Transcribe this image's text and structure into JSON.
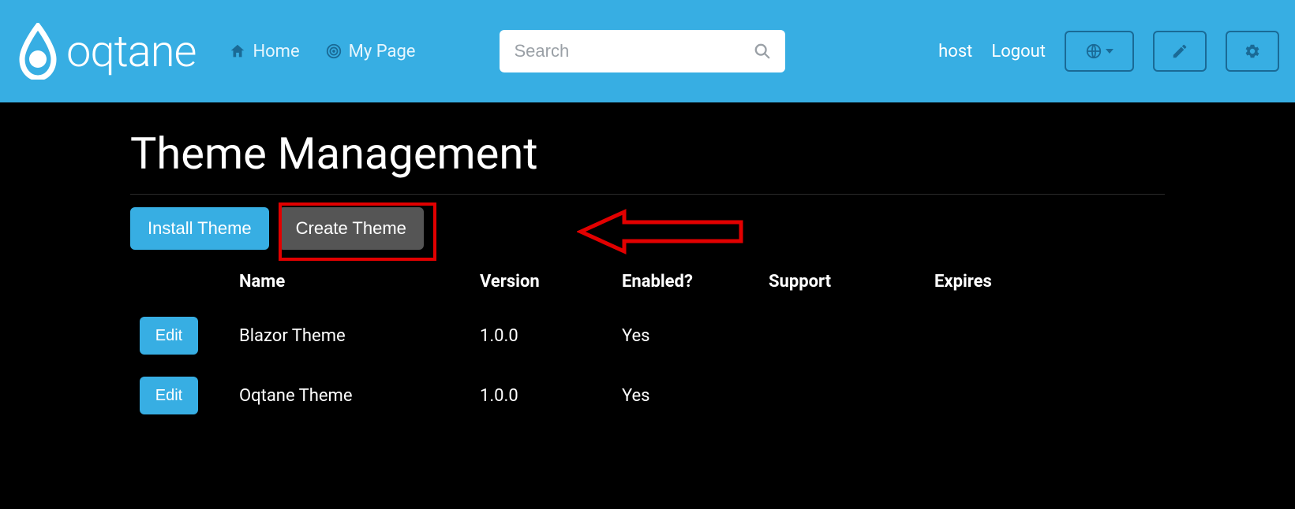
{
  "brand": {
    "name": "oqtane"
  },
  "nav": {
    "home": {
      "label": "Home"
    },
    "mypage": {
      "label": "My Page"
    }
  },
  "search": {
    "placeholder": "Search"
  },
  "user": {
    "name": "host",
    "logout": "Logout"
  },
  "page": {
    "title": "Theme Management",
    "install_label": "Install Theme",
    "create_label": "Create Theme"
  },
  "table": {
    "headers": {
      "name": "Name",
      "version": "Version",
      "enabled": "Enabled?",
      "support": "Support",
      "expires": "Expires"
    },
    "edit_label": "Edit",
    "rows": [
      {
        "name": "Blazor Theme",
        "version": "1.0.0",
        "enabled": "Yes",
        "support": "",
        "expires": ""
      },
      {
        "name": "Oqtane Theme",
        "version": "1.0.0",
        "enabled": "Yes",
        "support": "",
        "expires": ""
      }
    ]
  },
  "colors": {
    "accent": "#37aee3",
    "annotation": "#e20000"
  }
}
